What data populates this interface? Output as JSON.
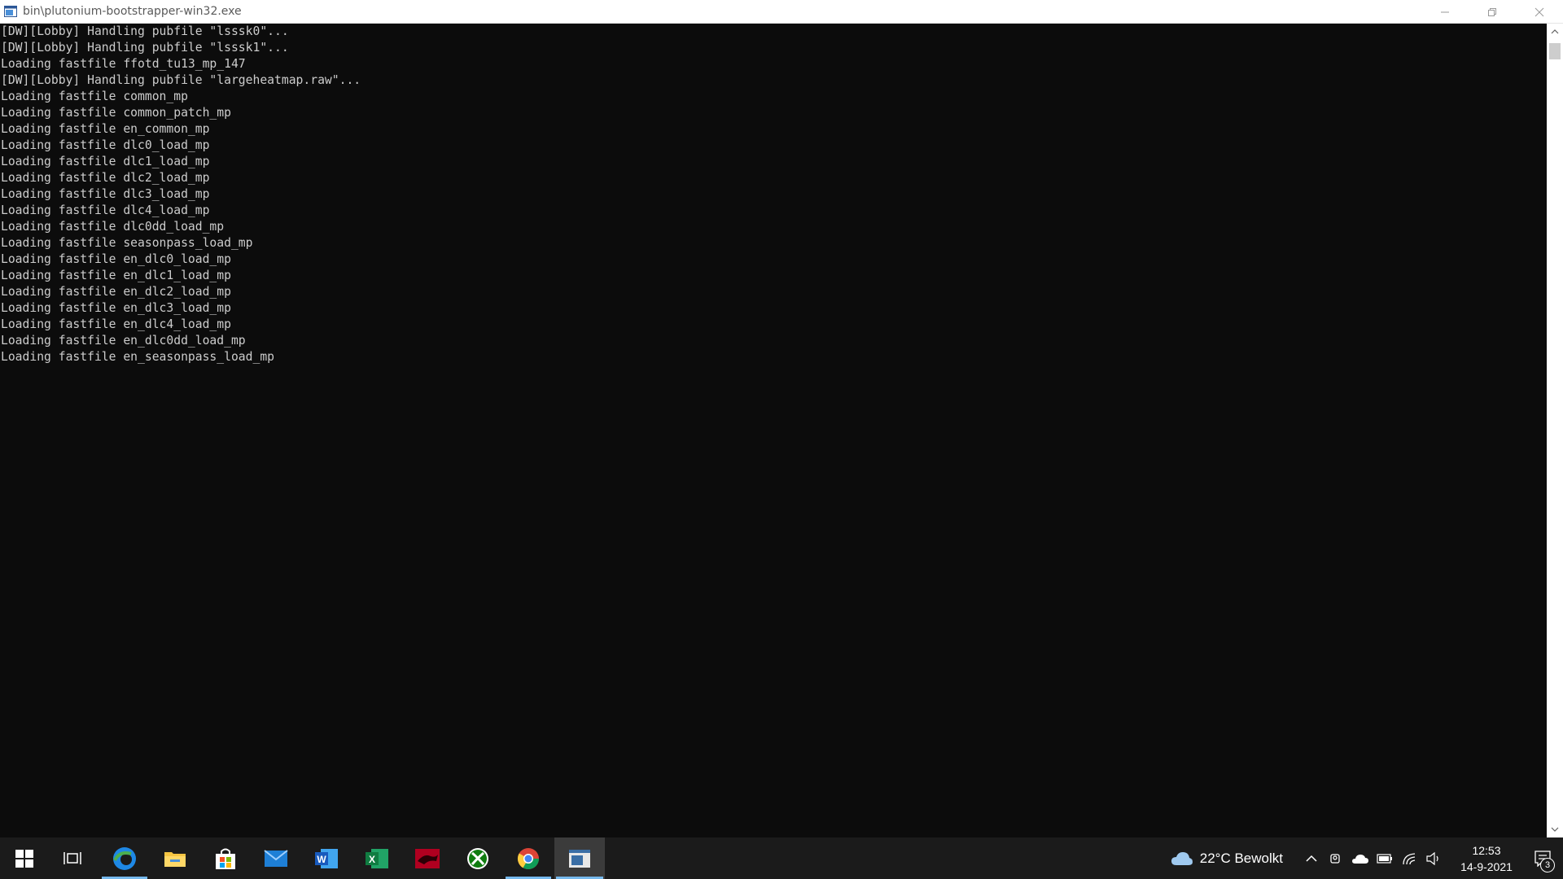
{
  "window": {
    "title": "bin\\plutonium-bootstrapper-win32.exe"
  },
  "console": {
    "lines": [
      "[DW][Lobby] Handling pubfile \"lsssk0\"...",
      "[DW][Lobby] Handling pubfile \"lsssk1\"...",
      "Loading fastfile ffotd_tu13_mp_147",
      "[DW][Lobby] Handling pubfile \"largeheatmap.raw\"...",
      "Loading fastfile common_mp",
      "Loading fastfile common_patch_mp",
      "Loading fastfile en_common_mp",
      "Loading fastfile dlc0_load_mp",
      "Loading fastfile dlc1_load_mp",
      "Loading fastfile dlc2_load_mp",
      "Loading fastfile dlc3_load_mp",
      "Loading fastfile dlc4_load_mp",
      "Loading fastfile dlc0dd_load_mp",
      "Loading fastfile seasonpass_load_mp",
      "Loading fastfile en_dlc0_load_mp",
      "Loading fastfile en_dlc1_load_mp",
      "Loading fastfile en_dlc2_load_mp",
      "Loading fastfile en_dlc3_load_mp",
      "Loading fastfile en_dlc4_load_mp",
      "Loading fastfile en_dlc0dd_load_mp",
      "Loading fastfile en_seasonpass_load_mp"
    ]
  },
  "taskbar": {
    "apps": [
      {
        "icon": "start-icon"
      },
      {
        "icon": "task-view-icon"
      },
      {
        "icon": "edge-icon",
        "running": true
      },
      {
        "icon": "file-explorer-icon"
      },
      {
        "icon": "store-icon"
      },
      {
        "icon": "mail-icon"
      },
      {
        "icon": "word-icon"
      },
      {
        "icon": "excel-icon"
      },
      {
        "icon": "red-app-icon"
      },
      {
        "icon": "xbox-icon"
      },
      {
        "icon": "chrome-icon",
        "running": true
      },
      {
        "icon": "console-icon",
        "running": true,
        "active": true
      }
    ],
    "weather": {
      "icon": "cloud-icon",
      "text": "22°C  Bewolkt"
    },
    "tray_icons": [
      "chevron-up-icon",
      "meet-now-icon",
      "onedrive-icon",
      "battery-icon",
      "wifi-icon",
      "volume-icon"
    ],
    "clock": {
      "time": "12:53",
      "date": "14-9-2021"
    },
    "notifications": {
      "count": "3"
    }
  },
  "colors": {
    "console_bg": "#0c0c0c",
    "console_text": "#cccccc",
    "taskbar_bg": "#1b1b1b",
    "running_indicator": "#76b9ed"
  }
}
